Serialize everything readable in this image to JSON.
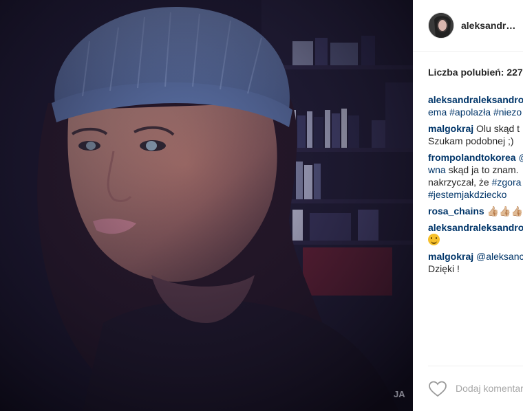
{
  "post": {
    "image_alt": "selfie",
    "watermark": "JA"
  },
  "header": {
    "username": "aleksandr…"
  },
  "likes": {
    "label": "Liczba polubień: 227"
  },
  "comments": [
    {
      "user": "aleksandraleksandro",
      "lines": [
        "ema #apolazła #niezo"
      ]
    },
    {
      "user": "malgokraj",
      "text1": " Olu skąd t",
      "line2": "Szukam podobnej ;)"
    },
    {
      "user": "frompolandtokorea",
      "text1": " @",
      "line2a": "wna",
      "line2b": " skąd ja to znam.",
      "line3a": "nakrzyczał, że ",
      "line3b": "#zgora",
      "line4": "#jestemjakdziecko"
    },
    {
      "user": "rosa_chains",
      "text1": " 👍🏼👍🏼👍🏼"
    },
    {
      "user": "aleksandraleksandro"
    },
    {
      "user": "malgokraj",
      "text1": " @aleksanc",
      "line2": "Dzięki !"
    }
  ],
  "actions": {
    "like_icon": "heart-icon",
    "comment_placeholder": "Dodaj komentarz..."
  },
  "colors": {
    "link": "#003569",
    "text": "#262626",
    "placeholder": "#a5a5a5"
  }
}
